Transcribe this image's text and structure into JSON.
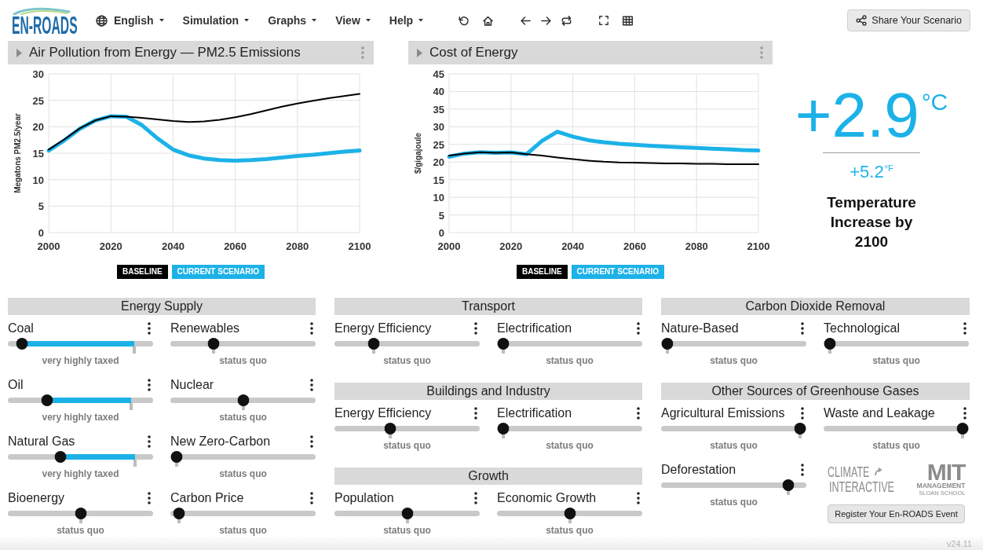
{
  "header": {
    "logo": "EN-ROADS",
    "menus": [
      {
        "kind": "language",
        "label": "English"
      },
      {
        "kind": "menu",
        "label": "Simulation"
      },
      {
        "kind": "menu",
        "label": "Graphs"
      },
      {
        "kind": "menu",
        "label": "View"
      },
      {
        "kind": "menu",
        "label": "Help"
      }
    ],
    "share_button": "Share Your Scenario"
  },
  "graphs": [
    {
      "chart_data": {
        "type": "line",
        "title": "Air Pollution from Energy — PM2.5 Emissions",
        "ylabel": "Megatons PM2.5/year",
        "x": [
          2000,
          2005,
          2010,
          2015,
          2020,
          2025,
          2030,
          2035,
          2040,
          2045,
          2050,
          2055,
          2060,
          2065,
          2070,
          2075,
          2080,
          2085,
          2090,
          2095,
          2100
        ],
        "xlim": [
          2000,
          2100
        ],
        "ylim": [
          0,
          30
        ],
        "xticks": [
          2000,
          2020,
          2040,
          2060,
          2080,
          2100
        ],
        "yticks": [
          0,
          5,
          10,
          15,
          20,
          25,
          30
        ],
        "grid": true,
        "series": [
          {
            "name": "BASELINE",
            "color": "#000000",
            "values": [
              15.7,
              17.6,
              19.7,
              21.2,
              22.0,
              21.9,
              21.7,
              21.4,
              21.1,
              20.9,
              21.0,
              21.3,
              21.8,
              22.4,
              23.1,
              23.8,
              24.4,
              24.9,
              25.4,
              25.8,
              26.2
            ]
          },
          {
            "name": "CURRENT SCENARIO",
            "color": "#1cb2e8",
            "values": [
              15.5,
              17.4,
              19.6,
              21.2,
              22.0,
              21.9,
              20.3,
              17.8,
              15.7,
              14.6,
              14.0,
              13.7,
              13.6,
              13.7,
              13.9,
              14.2,
              14.5,
              14.7,
              15.0,
              15.3,
              15.5
            ]
          }
        ]
      }
    },
    {
      "chart_data": {
        "type": "line",
        "title": "Cost of Energy",
        "ylabel": "$/gigajoule",
        "x": [
          2000,
          2005,
          2010,
          2015,
          2020,
          2025,
          2030,
          2035,
          2040,
          2045,
          2050,
          2055,
          2060,
          2065,
          2070,
          2075,
          2080,
          2085,
          2090,
          2095,
          2100
        ],
        "xlim": [
          2000,
          2100
        ],
        "ylim": [
          0,
          45
        ],
        "xticks": [
          2000,
          2020,
          2040,
          2060,
          2080,
          2100
        ],
        "yticks": [
          0,
          5,
          10,
          15,
          20,
          25,
          30,
          35,
          40,
          45
        ],
        "grid": true,
        "series": [
          {
            "name": "BASELINE",
            "color": "#000000",
            "values": [
              21.8,
              22.4,
              22.8,
              22.6,
              22.7,
              22.2,
              21.8,
              21.3,
              20.8,
              20.4,
              20.1,
              19.9,
              19.8,
              19.7,
              19.6,
              19.6,
              19.5,
              19.5,
              19.4,
              19.4,
              19.4
            ]
          },
          {
            "name": "CURRENT SCENARIO",
            "color": "#1cb2e8",
            "values": [
              21.5,
              22.4,
              22.8,
              22.6,
              22.7,
              22.2,
              26.0,
              28.6,
              27.2,
              26.2,
              25.6,
              25.2,
              24.9,
              24.6,
              24.4,
              24.2,
              24.0,
              23.8,
              23.6,
              23.4,
              23.3
            ]
          }
        ]
      }
    }
  ],
  "temperature": {
    "celsius": {
      "value": "+2.9",
      "unit": "°C"
    },
    "fahrenheit": {
      "value": "+5.2",
      "unit": "°F"
    },
    "caption": "Temperature Increase by 2100"
  },
  "slider_columns": [
    {
      "groups": [
        {
          "title": "Energy Supply",
          "sliders": [
            {
              "label": "Coal",
              "level": 0.06,
              "default_marker": {
                "level": 0.87
              },
              "caption": "very highly taxed"
            },
            {
              "label": "Renewables",
              "level": 0.28,
              "caption": "status quo"
            },
            {
              "label": "Oil",
              "level": 0.25,
              "default_marker": {
                "level": 0.85
              },
              "caption": "very highly taxed"
            },
            {
              "label": "Nuclear",
              "level": 0.5,
              "caption": "status quo"
            },
            {
              "label": "Natural Gas",
              "level": 0.35,
              "default_marker": {
                "level": 0.875
              },
              "caption": "very highly taxed"
            },
            {
              "label": "New Zero-Carbon",
              "level": 0.0,
              "caption": "status quo"
            },
            {
              "label": "Bioenergy",
              "level": 0.5,
              "caption": "status quo"
            },
            {
              "label": "Carbon Price",
              "level": 0.02,
              "caption": "status quo"
            }
          ]
        }
      ]
    },
    {
      "groups": [
        {
          "title": "Transport",
          "sliders": [
            {
              "label": "Energy Efficiency",
              "level": 0.25,
              "caption": "status quo"
            },
            {
              "label": "Electrification",
              "level": 0.0,
              "caption": "status quo"
            }
          ]
        },
        {
          "title": "Buildings and Industry",
          "sliders": [
            {
              "label": "Energy Efficiency",
              "level": 0.37,
              "caption": "status quo"
            },
            {
              "label": "Electrification",
              "level": 0.0,
              "caption": "status quo"
            }
          ]
        },
        {
          "title": "Growth",
          "sliders": [
            {
              "label": "Population",
              "level": 0.5,
              "caption": "status quo"
            },
            {
              "label": "Economic Growth",
              "level": 0.5,
              "caption": "status quo"
            }
          ]
        }
      ]
    },
    {
      "groups": [
        {
          "title": "Carbon Dioxide Removal",
          "sliders": [
            {
              "label": "Nature-Based",
              "level": 0.0,
              "caption": "status quo"
            },
            {
              "label": "Technological",
              "level": 0.0,
              "caption": "status quo"
            }
          ]
        },
        {
          "title": "Other Sources of Greenhouse Gases",
          "sliders": [
            {
              "label": "Agricultural Emissions",
              "level": 1.0,
              "caption": "status quo"
            },
            {
              "label": "Waste and Leakage",
              "level": 1.0,
              "caption": "status quo"
            },
            {
              "label": "Deforestation",
              "level": 0.91,
              "caption": "status quo"
            }
          ]
        }
      ]
    }
  ],
  "branding": {
    "partner_logos": [
      {
        "kind": "climate",
        "lines": [
          "CLIMATE",
          "INTERACTIVE"
        ]
      },
      {
        "kind": "mit",
        "lines": [
          "MIT",
          "MANAGEMENT",
          "SLOAN SCHOOL"
        ]
      }
    ],
    "register_button": "Register Your En-ROADS Event"
  },
  "version": "v24.11"
}
